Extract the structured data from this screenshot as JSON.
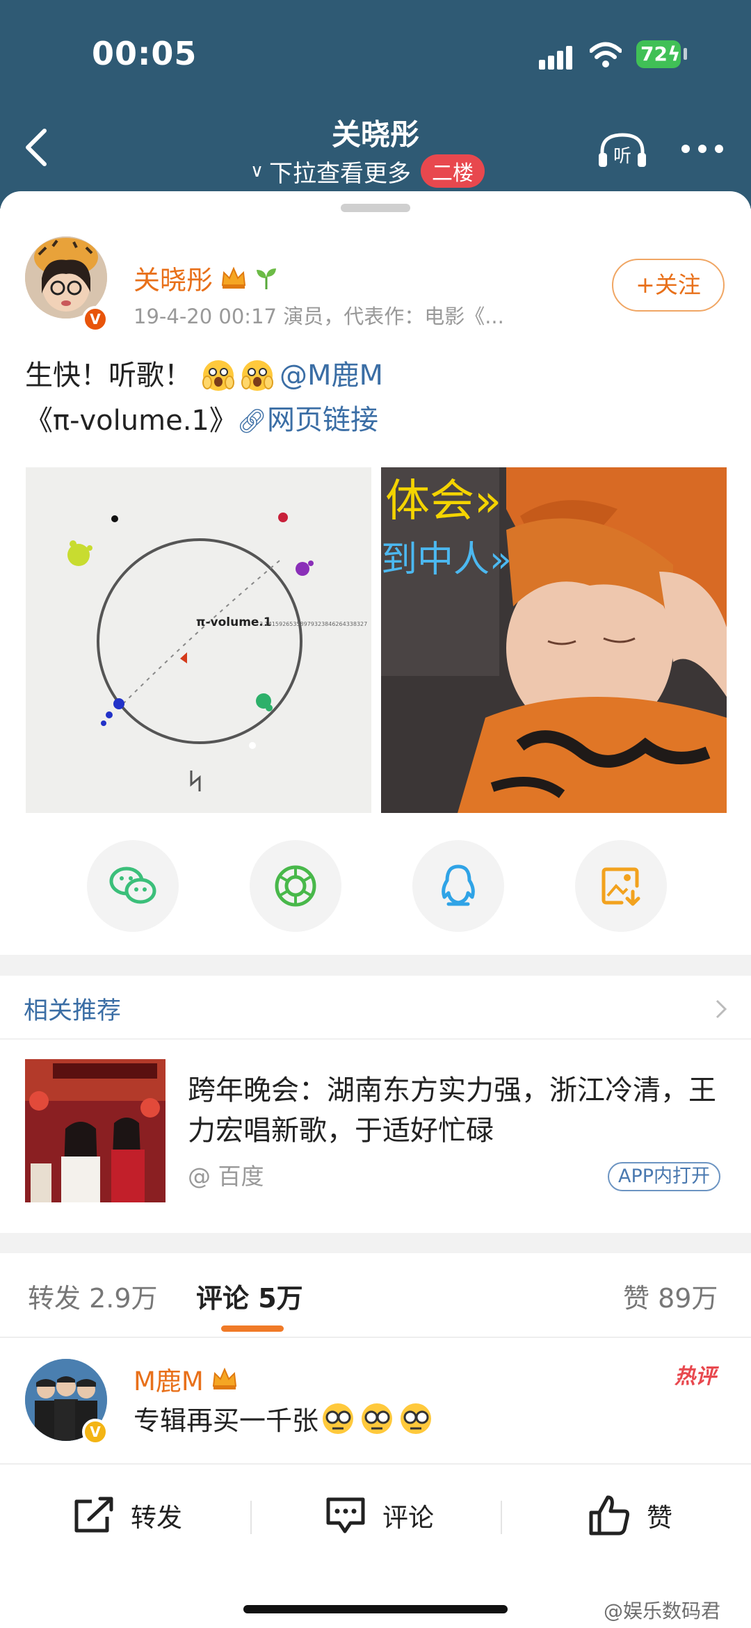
{
  "status_bar": {
    "time": "00:05",
    "battery": "72"
  },
  "header": {
    "title": "关晓彤",
    "subtitle": "下拉查看更多",
    "floor_badge": "二楼",
    "listen_label": "听"
  },
  "post": {
    "author": "关晓彤",
    "meta": "19-4-20 00:17  演员，代表作：电影《...",
    "follow_label": "+关注",
    "verified_label": "V",
    "text_part1": "生快！听歌！",
    "mention": "@M鹿M",
    "album": "《π-volume.1》",
    "link_text": "网页链接",
    "image1_caption": "π-volume.1"
  },
  "recommend": {
    "heading": "相关推荐",
    "title": "跨年晚会：湖南东方实力强，浙江冷清，王力宏唱新歌，于适好忙碌",
    "source": "@ 百度",
    "app_label": "APP内打开"
  },
  "tabs": {
    "repost": "转发 2.9万",
    "comment": "评论 5万",
    "like": "赞 89万"
  },
  "comment": {
    "author": "M鹿M",
    "text": "专辑再买一千张",
    "hot_label": "热评"
  },
  "bottom_bar": {
    "repost": "转发",
    "comment": "评论",
    "like": "赞"
  },
  "watermark": "@娱乐数码君",
  "colors": {
    "header_bg": "#2f5a74",
    "accent_orange": "#e8701a",
    "link_blue": "#3b6ea5",
    "hot_red": "#e8484e"
  }
}
